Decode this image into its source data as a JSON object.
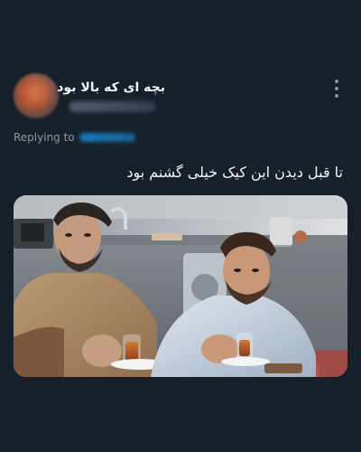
{
  "tweet": {
    "author_name": "بچه ای که بالا بود",
    "reply_label": "Replying to",
    "body": "تا قبل دیدن این کیک خیلی گشنم بود"
  },
  "colors": {
    "background": "#15202b",
    "text_primary": "#f1f5f9",
    "text_secondary": "#8b98a5",
    "mention": "#1d9bf0"
  },
  "icons": {
    "menu": "more-vertical-icon"
  }
}
